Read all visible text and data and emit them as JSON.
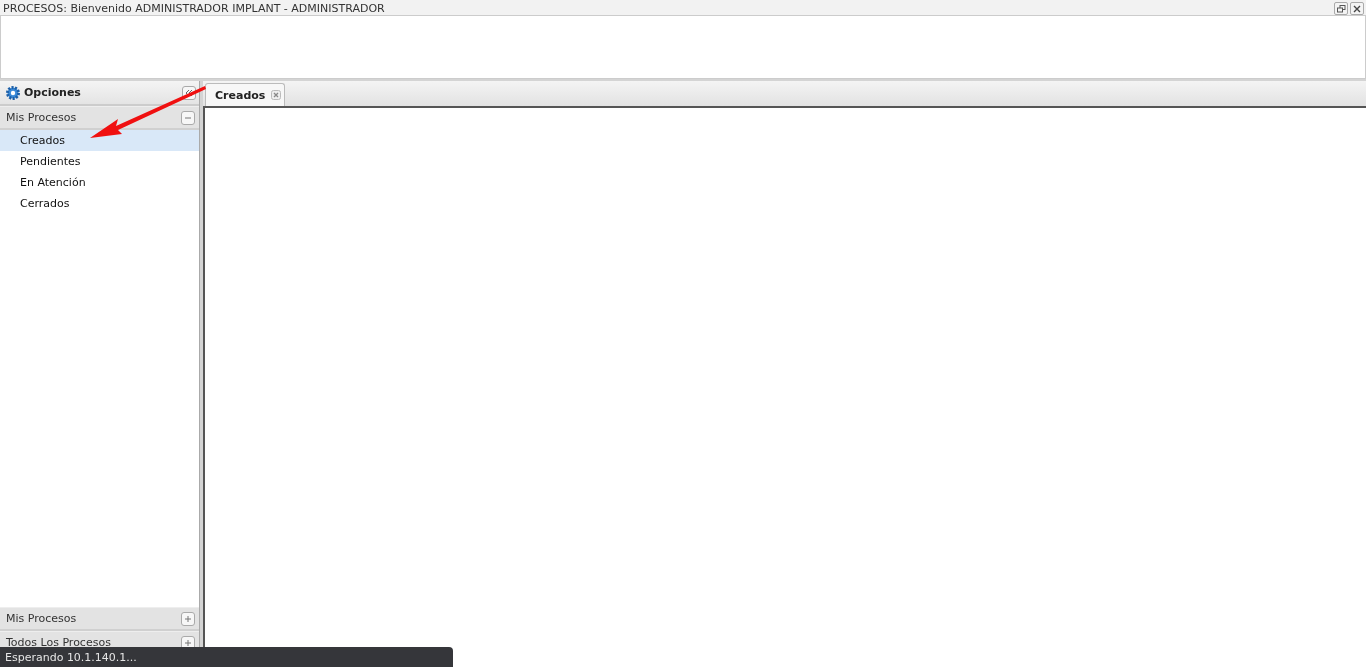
{
  "window": {
    "title": "PROCESOS: Bienvenido ADMINISTRADOR IMPLANT - ADMINISTRADOR"
  },
  "sidebar": {
    "title": "Opciones",
    "sections": [
      {
        "label": "Mis Procesos",
        "expanded": true,
        "items": [
          {
            "label": "Creados",
            "selected": true
          },
          {
            "label": "Pendientes",
            "selected": false
          },
          {
            "label": "En Atención",
            "selected": false
          },
          {
            "label": "Cerrados",
            "selected": false
          }
        ]
      },
      {
        "label": "Mis Procesos",
        "expanded": false
      },
      {
        "label": "Todos Los Procesos",
        "expanded": false
      }
    ]
  },
  "tabs": [
    {
      "label": "Creados",
      "selected": true
    }
  ],
  "status": "Esperando 10.1.140.1..."
}
